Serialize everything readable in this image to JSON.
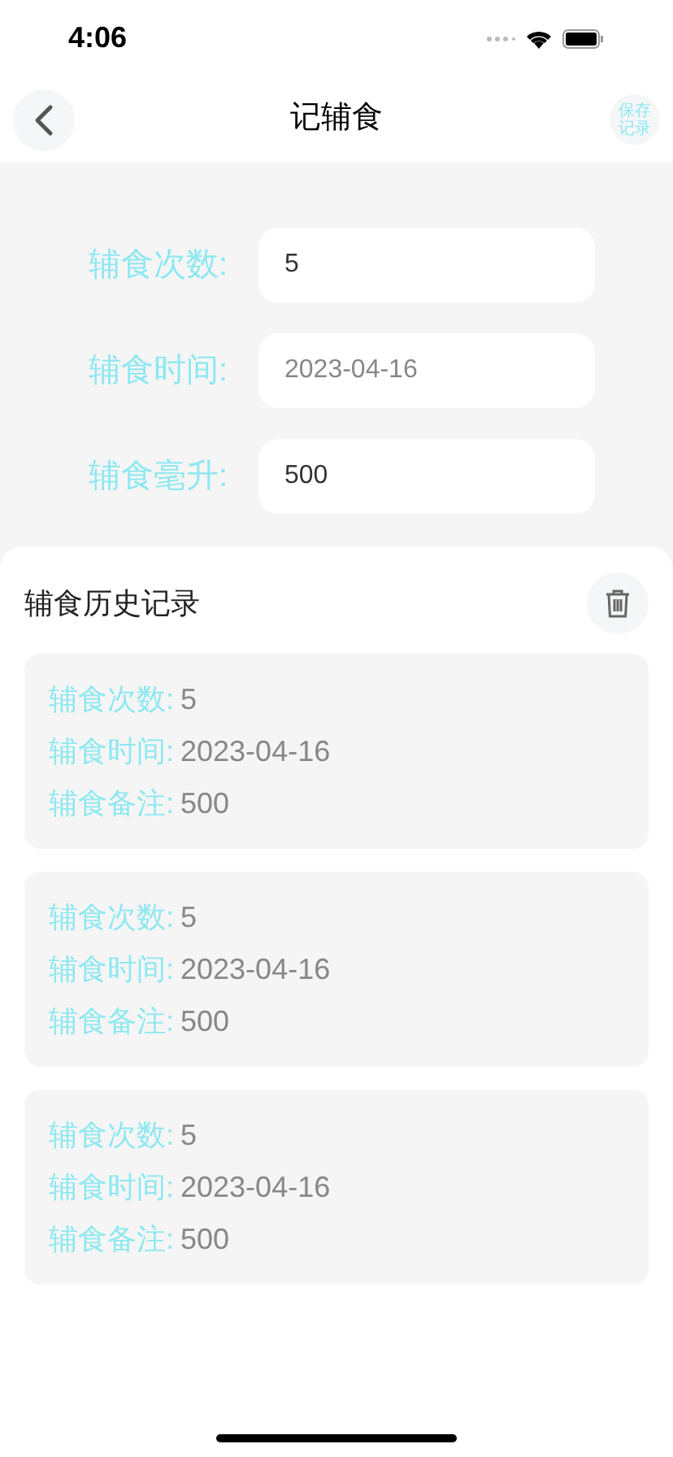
{
  "status_bar": {
    "time": "4:06"
  },
  "nav": {
    "title": "记辅食",
    "save_button": [
      "保存",
      "记录"
    ]
  },
  "form": [
    {
      "label": "辅食次数:",
      "value": "5"
    },
    {
      "label": "辅食时间:",
      "placeholder": "2023-04-16"
    },
    {
      "label": "辅食毫升:",
      "value": "500"
    }
  ],
  "history": {
    "title": "辅食历史记录",
    "records": [
      [
        {
          "label": "辅食次数:",
          "value": "5"
        },
        {
          "label": "辅食时间:",
          "value": "2023-04-16"
        },
        {
          "label": "辅食备注:",
          "value": "500"
        }
      ],
      [
        {
          "label": "辅食次数:",
          "value": "5"
        },
        {
          "label": "辅食时间:",
          "value": "2023-04-16"
        },
        {
          "label": "辅食备注:",
          "value": "500"
        }
      ],
      [
        {
          "label": "辅食次数:",
          "value": "5"
        },
        {
          "label": "辅食时间:",
          "value": "2023-04-16"
        },
        {
          "label": "辅食备注:",
          "value": "500"
        }
      ]
    ]
  }
}
